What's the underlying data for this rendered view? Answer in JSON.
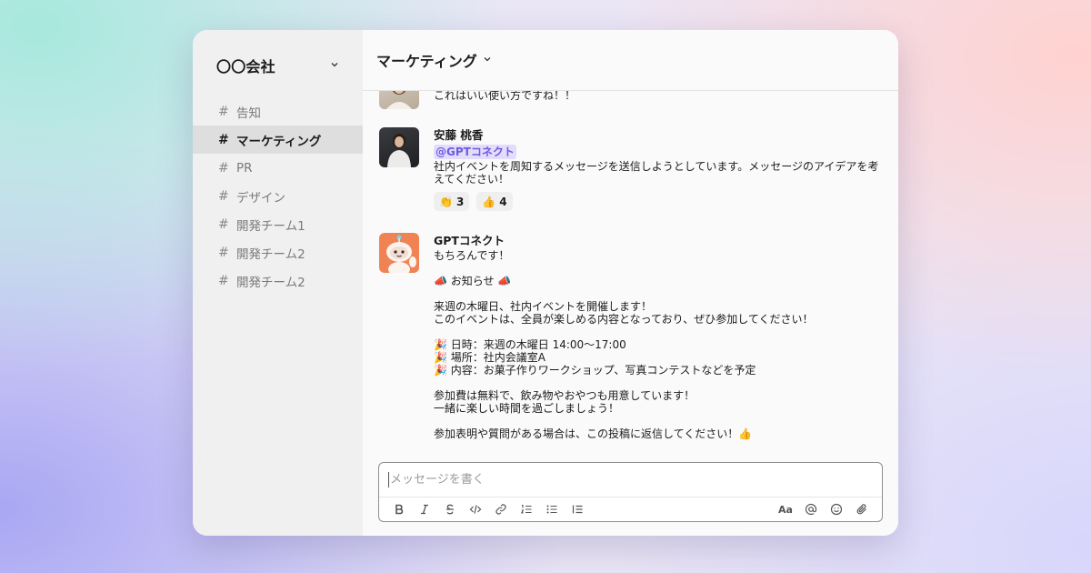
{
  "workspace": {
    "name": "〇〇会社"
  },
  "sidebar": {
    "channels": [
      {
        "label": "告知",
        "active": false
      },
      {
        "label": "マーケティング",
        "active": true
      },
      {
        "label": "PR",
        "active": false
      },
      {
        "label": "デザイン",
        "active": false
      },
      {
        "label": "開発チーム1",
        "active": false
      },
      {
        "label": "開発チーム2",
        "active": false
      },
      {
        "label": "開発チーム2",
        "active": false
      }
    ]
  },
  "header": {
    "channel": "マーケティング"
  },
  "messages": [
    {
      "text": "これはいい使い方ですね！！"
    },
    {
      "sender": "安藤 桃香",
      "mention": "@GPTコネクト",
      "text": "社内イベントを周知するメッセージを送信しようとしています。メッセージのアイデアを考えてください！",
      "reactions": [
        {
          "emoji": "👏",
          "count": "3"
        },
        {
          "emoji": "👍",
          "count": "4"
        }
      ]
    },
    {
      "sender": "GPTコネクト",
      "text": "もちろんです！\n\n📣 お知らせ 📣\n\n来週の木曜日、社内イベントを開催します！\nこのイベントは、全員が楽しめる内容となっており、ぜひ参加してください！\n\n🎉 日時：来週の木曜日 14:00〜17:00\n🎉 場所：社内会議室A\n🎉 内容：お菓子作りワークショップ、写真コンテストなどを予定\n\n参加費は無料で、飲み物やおやつも用意しています！\n一緒に楽しい時間を過ごしましょう！\n\n参加表明や質問がある場合は、この投稿に返信してください！👍"
    }
  ],
  "composer": {
    "placeholder": "メッセージを書く",
    "format_label": "Aa"
  },
  "colors": {
    "accent": "#6c5ce0",
    "mention_bg": "#e4dcfb",
    "bot_avatar": "#ef8354"
  }
}
